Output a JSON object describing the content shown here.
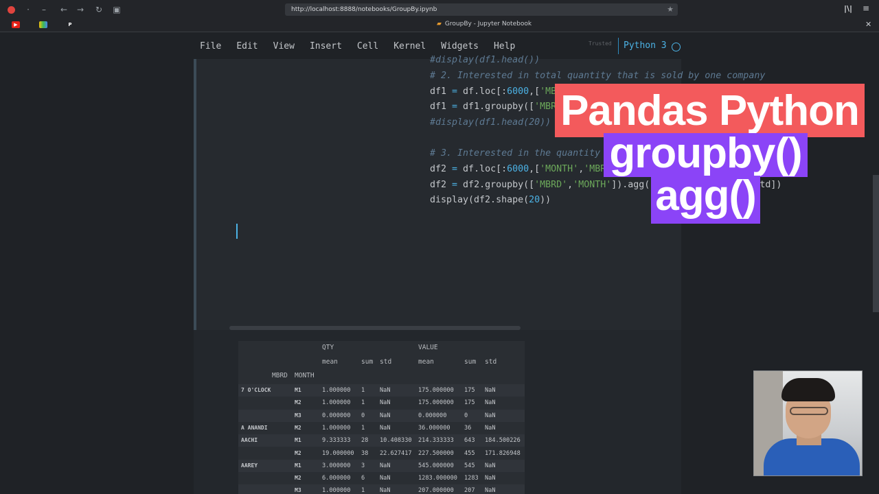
{
  "browser": {
    "url": "http://localhost:8888/notebooks/GroupBy.ipynb",
    "tab_title": "GroupBy - Jupyter Notebook",
    "icons": [
      "back-icon",
      "forward-icon",
      "reload-icon",
      "screenshot-icon",
      "bookmark-star-icon",
      "library-icon",
      "menu-icon"
    ]
  },
  "menu": {
    "items": [
      "File",
      "Edit",
      "View",
      "Insert",
      "Cell",
      "Kernel",
      "Widgets",
      "Help"
    ],
    "trusted": "Trusted",
    "kernel": "Python 3"
  },
  "code": {
    "line0": "#display(df1.head())",
    "line1": "# 2. Interested in total quantity that is sold by one company",
    "line4": "#display(df1.head(20))",
    "line6": "# 3. Interested in the quantity of item sold by a company in r"
  },
  "overlay": {
    "line1": "Pandas Python",
    "line2": "groupby()",
    "line3": "agg()"
  },
  "table": {
    "top_headers": [
      "QTY",
      "VALUE"
    ],
    "sub_headers": [
      "mean",
      "sum",
      "std",
      "mean",
      "sum",
      "std"
    ],
    "index_headers": [
      "MBRD",
      "MONTH"
    ],
    "rows": [
      {
        "mbrd": "7 O'CLOCK",
        "month": "M1",
        "c": [
          "1.000000",
          "1",
          "NaN",
          "175.000000",
          "175",
          "NaN"
        ]
      },
      {
        "mbrd": "",
        "month": "M2",
        "c": [
          "1.000000",
          "1",
          "NaN",
          "175.000000",
          "175",
          "NaN"
        ]
      },
      {
        "mbrd": "",
        "month": "M3",
        "c": [
          "0.000000",
          "0",
          "NaN",
          "0.000000",
          "0",
          "NaN"
        ]
      },
      {
        "mbrd": "A ANANDI",
        "month": "M2",
        "c": [
          "1.000000",
          "1",
          "NaN",
          "36.000000",
          "36",
          "NaN"
        ]
      },
      {
        "mbrd": "AACHI",
        "month": "M1",
        "c": [
          "9.333333",
          "28",
          "10.408330",
          "214.333333",
          "643",
          "184.500226"
        ]
      },
      {
        "mbrd": "",
        "month": "M2",
        "c": [
          "19.000000",
          "38",
          "22.627417",
          "227.500000",
          "455",
          "171.826948"
        ]
      },
      {
        "mbrd": "AAREY",
        "month": "M1",
        "c": [
          "3.000000",
          "3",
          "NaN",
          "545.000000",
          "545",
          "NaN"
        ]
      },
      {
        "mbrd": "",
        "month": "M2",
        "c": [
          "6.000000",
          "6",
          "NaN",
          "1283.000000",
          "1283",
          "NaN"
        ]
      },
      {
        "mbrd": "",
        "month": "M3",
        "c": [
          "1.000000",
          "1",
          "NaN",
          "207.000000",
          "207",
          "NaN"
        ]
      }
    ]
  }
}
